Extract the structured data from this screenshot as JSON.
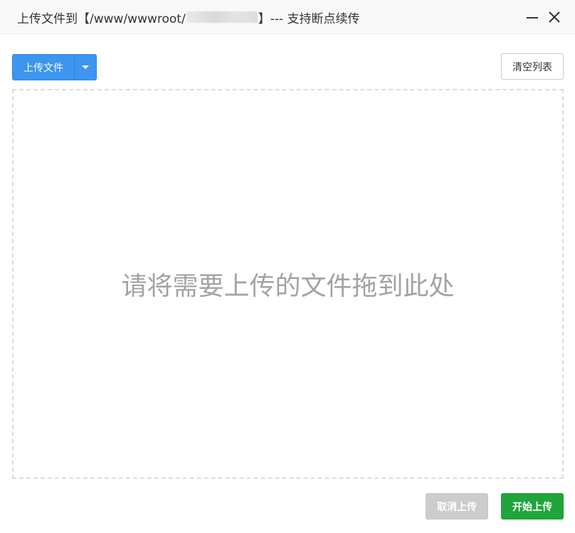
{
  "titlebar": {
    "title_prefix": "上传文件到【/www/wwwroot/",
    "title_suffix": "】--- 支持断点续传",
    "minimize_icon": "minimize-icon",
    "close_icon": "close-icon"
  },
  "toolbar": {
    "upload_label": "上传文件",
    "dropdown_icon": "caret-down-icon",
    "clear_label": "清空列表"
  },
  "drop_zone": {
    "hint": "请将需要上传的文件拖到此处"
  },
  "footer": {
    "cancel_label": "取消上传",
    "start_label": "开始上传"
  },
  "colors": {
    "primary": "#3d95f0",
    "success": "#20a53a",
    "disabled": "#cccccc",
    "hint_text": "#a3a3a3"
  }
}
